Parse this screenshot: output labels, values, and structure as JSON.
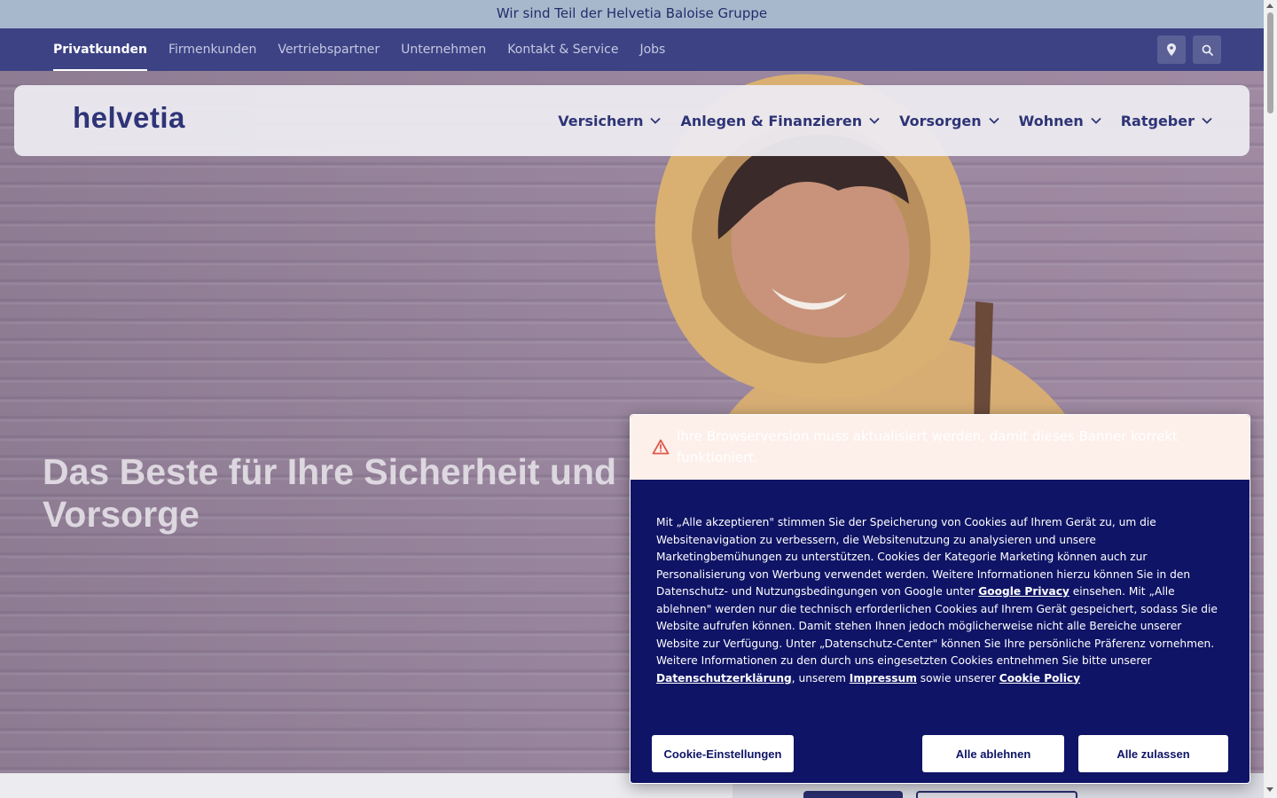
{
  "announcement": "Wir sind Teil der Helvetia Baloise Gruppe",
  "topnav": {
    "links": [
      "Privatkunden",
      "Firmenkunden",
      "Vertriebspartner",
      "Unternehmen",
      "Kontakt & Service",
      "Jobs"
    ],
    "active": "Privatkunden",
    "icons": [
      "location-icon",
      "search-icon"
    ]
  },
  "header": {
    "logo": "helvetia",
    "menu": [
      "Versichern",
      "Anlegen & Finanzieren",
      "Vorsorgen",
      "Wohnen",
      "Ratgeber"
    ]
  },
  "hero": {
    "headline_line1": "Das Beste für Ihre Sicherheit und",
    "headline_line2": "Vorsorge"
  },
  "cookie_banner": {
    "warning": "Ihre Browserversion muss aktualisiert werden, damit dieses Banner korrekt funktioniert.",
    "text_1": "Mit „Alle akzeptieren\" stimmen Sie der Speicherung von Cookies auf Ihrem Gerät zu, um die Websitenavigation zu verbessern, die Websitenutzung zu analysieren und unsere Marketingbemühungen zu unterstützen. Cookies der Kategorie Marketing können auch zur Personalisierung von Werbung verwendet werden. Weitere Informationen hierzu können Sie in den Datenschutz- und Nutzungsbedingungen von Google unter ",
    "link_google": "Google Privacy",
    "text_2": " einsehen. Mit „Alle ablehnen\" werden nur die technisch erforderlichen Cookies auf Ihrem Gerät gespeichert, sodass Sie die Website aufrufen können. Damit stehen Ihnen jedoch möglicherweise nicht alle Bereiche unserer Website zur Verfügung. Unter „Datenschutz-Center\" können Sie Ihre persönliche Präferenz vornehmen. Weitere Informationen zu den durch uns eingesetzten Cookies entnehmen Sie bitte unserer ",
    "link_datenschutz": "Datenschutzerklärung",
    "text_3": ", unserem ",
    "link_impressum": "Impressum",
    "text_4": " sowie unserer ",
    "link_cookie_policy": "Cookie Policy",
    "btn_settings": "Cookie-Einstellungen",
    "btn_reject": "Alle ablehnen",
    "btn_accept": "Alle zulassen"
  },
  "colors": {
    "brand": "#2e3476",
    "topnav_bg": "#3c4284",
    "cookie_bg": "#0f1466",
    "warning_bg": "#fdf0ea",
    "warning_icon": "#e0574a"
  }
}
